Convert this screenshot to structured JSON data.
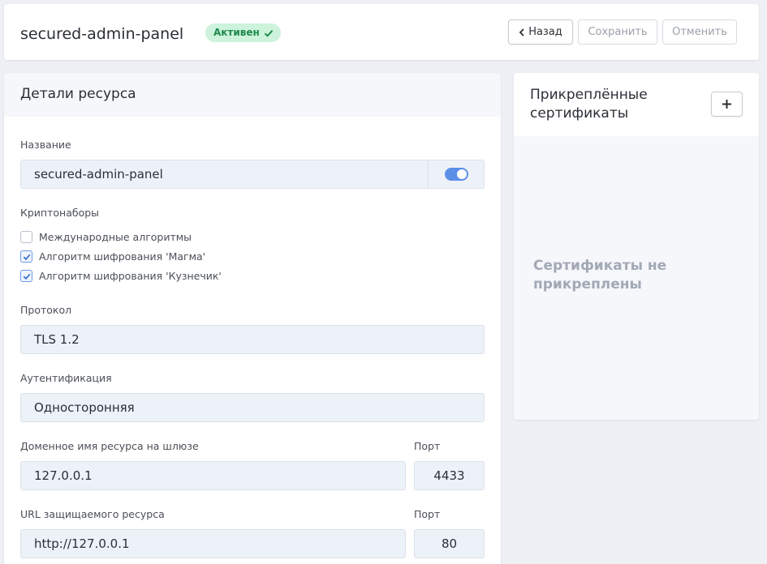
{
  "header": {
    "title": "secured-admin-panel",
    "status": "Активен",
    "back_label": "Назад",
    "save_label": "Сохранить",
    "cancel_label": "Отменить"
  },
  "details": {
    "title": "Детали ресурса",
    "name_label": "Название",
    "name_value": "secured-admin-panel",
    "name_toggle_on": true,
    "ciphers_label": "Криптонаборы",
    "ciphers": [
      {
        "label": "Международные алгоритмы",
        "checked": false
      },
      {
        "label": "Алгоритм шифрования 'Магма'",
        "checked": true
      },
      {
        "label": "Алгоритм шифрования 'Кузнечик'",
        "checked": true
      }
    ],
    "protocol_label": "Протокол",
    "protocol_value": "TLS 1.2",
    "auth_label": "Аутентификация",
    "auth_value": "Односторонняя",
    "gateway_label": "Доменное имя ресурса на шлюзе",
    "gateway_value": "127.0.0.1",
    "gateway_port_label": "Порт",
    "gateway_port_value": "4433",
    "url_label": "URL защищаемого ресурса",
    "url_value": "http://127.0.0.1",
    "url_port_label": "Порт",
    "url_port_value": "80"
  },
  "certificates": {
    "title": "Прикреплённые сертификаты",
    "empty_message": "Сертификаты не прикреплены"
  },
  "colors": {
    "accent": "#5b8fe8",
    "status_bg": "#cdf3dc",
    "status_text": "#1f8a4c"
  }
}
